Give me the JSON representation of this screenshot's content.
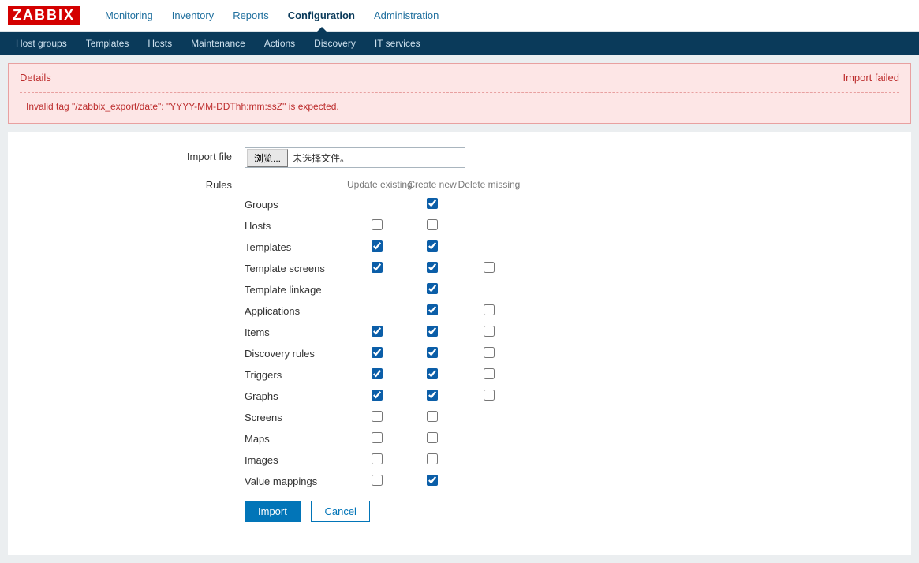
{
  "logo": "ZABBIX",
  "topnav": {
    "items": [
      "Monitoring",
      "Inventory",
      "Reports",
      "Configuration",
      "Administration"
    ],
    "active": "Configuration"
  },
  "subnav": {
    "items": [
      "Host groups",
      "Templates",
      "Hosts",
      "Maintenance",
      "Actions",
      "Discovery",
      "IT services"
    ]
  },
  "message": {
    "title": "Details",
    "status": "Import failed",
    "detail": "Invalid tag \"/zabbix_export/date\": \"YYYY-MM-DDThh:mm:ssZ\" is expected."
  },
  "form": {
    "import_file_label": "Import file",
    "browse_label": "浏览...",
    "no_file_text": "未选择文件。",
    "rules_label": "Rules",
    "headers": {
      "update": "Update existing",
      "create": "Create new",
      "delete": "Delete missing"
    },
    "rules": [
      {
        "label": "Groups",
        "update": null,
        "create": true,
        "delete": null
      },
      {
        "label": "Hosts",
        "update": false,
        "create": false,
        "delete": null
      },
      {
        "label": "Templates",
        "update": true,
        "create": true,
        "delete": null
      },
      {
        "label": "Template screens",
        "update": true,
        "create": true,
        "delete": false
      },
      {
        "label": "Template linkage",
        "update": null,
        "create": true,
        "delete": null
      },
      {
        "label": "Applications",
        "update": null,
        "create": true,
        "delete": false
      },
      {
        "label": "Items",
        "update": true,
        "create": true,
        "delete": false
      },
      {
        "label": "Discovery rules",
        "update": true,
        "create": true,
        "delete": false
      },
      {
        "label": "Triggers",
        "update": true,
        "create": true,
        "delete": false
      },
      {
        "label": "Graphs",
        "update": true,
        "create": true,
        "delete": false
      },
      {
        "label": "Screens",
        "update": false,
        "create": false,
        "delete": null
      },
      {
        "label": "Maps",
        "update": false,
        "create": false,
        "delete": null
      },
      {
        "label": "Images",
        "update": false,
        "create": false,
        "delete": null
      },
      {
        "label": "Value mappings",
        "update": false,
        "create": true,
        "delete": null
      }
    ],
    "buttons": {
      "import": "Import",
      "cancel": "Cancel"
    }
  }
}
